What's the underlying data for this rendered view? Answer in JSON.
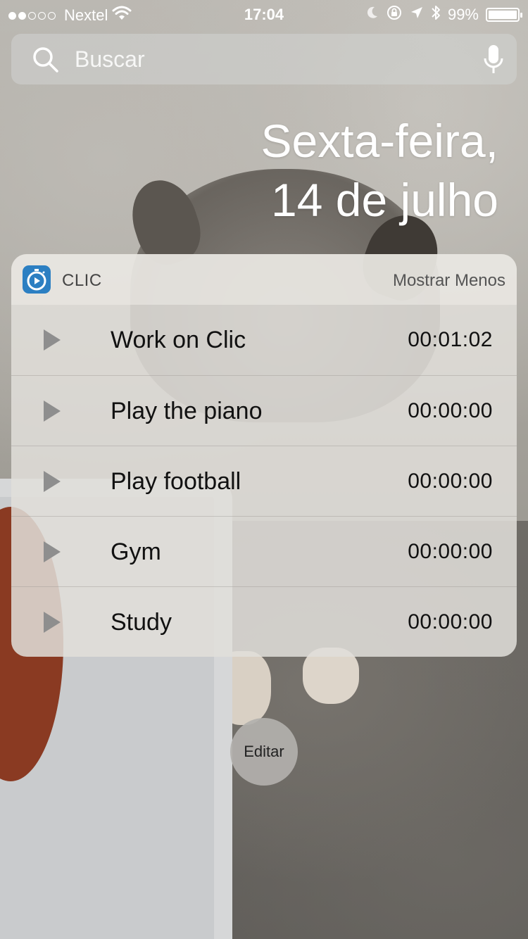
{
  "status_bar": {
    "carrier": "Nextel",
    "time": "17:04",
    "battery": "99%",
    "battery_level": 0.99,
    "signal_bars_filled": 2,
    "signal_bars_total": 5
  },
  "search": {
    "placeholder": "Buscar"
  },
  "date": {
    "line1": "Sexta-feira,",
    "line2": "14 de julho"
  },
  "widget": {
    "app_name": "CLIC",
    "show_less_label": "Mostrar Menos",
    "app_icon_color": "#2c7fc2",
    "tasks": [
      {
        "name": "Work on Clic",
        "time": "00:01:02"
      },
      {
        "name": "Play the piano",
        "time": "00:00:00"
      },
      {
        "name": "Play football",
        "time": "00:00:00"
      },
      {
        "name": "Gym",
        "time": "00:00:00"
      },
      {
        "name": "Study",
        "time": "00:00:00"
      }
    ]
  },
  "edit_button": {
    "label": "Editar"
  },
  "icons": {
    "status": [
      "wifi-icon",
      "moon-icon",
      "rotation-lock-icon",
      "location-arrow-icon",
      "bluetooth-icon",
      "battery-icon"
    ],
    "search": "search-icon",
    "mic": "microphone-icon",
    "task": "play-icon",
    "app": "stopwatch-icon"
  }
}
